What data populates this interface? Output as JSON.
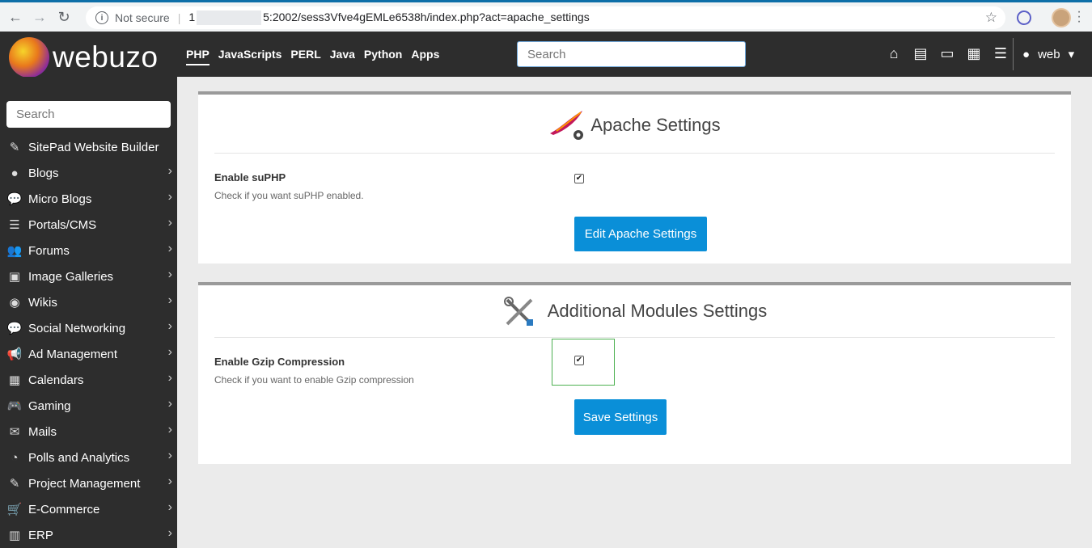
{
  "browser": {
    "security_label": "Not secure",
    "url_prefix": "1",
    "url_suffix": "5:2002/sess3Vfve4gEMLe6538h/index.php?act=apache_settings"
  },
  "header": {
    "logo_text": "webuzo",
    "nav": [
      "PHP",
      "JavaScripts",
      "PERL",
      "Java",
      "Python",
      "Apps"
    ],
    "active_nav": "PHP",
    "search_placeholder": "Search",
    "user_label": "web"
  },
  "sidebar": {
    "search_placeholder": "Search",
    "items": [
      {
        "label": "SitePad Website Builder",
        "icon": "paint-icon",
        "glyph": "✎",
        "has_arrow": false
      },
      {
        "label": "Blogs",
        "icon": "user-icon",
        "glyph": "●",
        "has_arrow": true
      },
      {
        "label": "Micro Blogs",
        "icon": "chat-bubbles-icon",
        "glyph": "💬",
        "has_arrow": true
      },
      {
        "label": "Portals/CMS",
        "icon": "list-icon",
        "glyph": "☰",
        "has_arrow": true
      },
      {
        "label": "Forums",
        "icon": "users-icon",
        "glyph": "👥",
        "has_arrow": true
      },
      {
        "label": "Image Galleries",
        "icon": "image-icon",
        "glyph": "▣",
        "has_arrow": true
      },
      {
        "label": "Wikis",
        "icon": "globe-icon",
        "glyph": "◉",
        "has_arrow": true
      },
      {
        "label": "Social Networking",
        "icon": "comments-icon",
        "glyph": "💬",
        "has_arrow": true
      },
      {
        "label": "Ad Management",
        "icon": "megaphone-icon",
        "glyph": "📢",
        "has_arrow": true
      },
      {
        "label": "Calendars",
        "icon": "calendar-icon",
        "glyph": "▦",
        "has_arrow": true
      },
      {
        "label": "Gaming",
        "icon": "gamepad-icon",
        "glyph": "🎮",
        "has_arrow": true
      },
      {
        "label": "Mails",
        "icon": "envelope-icon",
        "glyph": "✉",
        "has_arrow": true
      },
      {
        "label": "Polls and Analytics",
        "icon": "pie-chart-icon",
        "glyph": "◔",
        "has_arrow": true
      },
      {
        "label": "Project Management",
        "icon": "edit-icon",
        "glyph": "✎",
        "has_arrow": true
      },
      {
        "label": "E-Commerce",
        "icon": "cart-icon",
        "glyph": "🛒",
        "has_arrow": true
      },
      {
        "label": "ERP",
        "icon": "bar-chart-icon",
        "glyph": "▥",
        "has_arrow": true
      }
    ]
  },
  "apache_panel": {
    "title": "Apache Settings",
    "option_label": "Enable suPHP",
    "option_help": "Check if you want suPHP enabled.",
    "checked": true,
    "button_label": "Edit Apache Settings"
  },
  "modules_panel": {
    "title": "Additional Modules Settings",
    "option_label": "Enable Gzip Compression",
    "option_help": "Check if you want to enable Gzip compression",
    "checked": true,
    "button_label": "Save Settings"
  }
}
